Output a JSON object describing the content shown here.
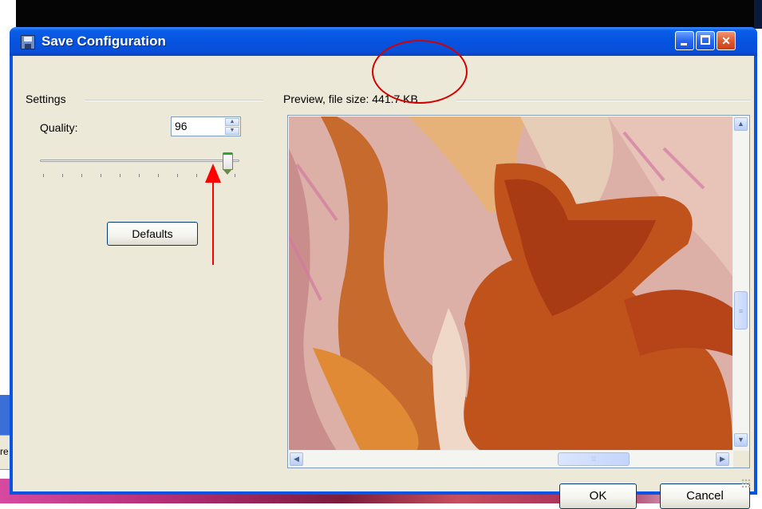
{
  "window": {
    "title": "Save Configuration",
    "controls": {
      "minimize": "minimize",
      "maximize": "maximize",
      "close": "close"
    }
  },
  "settings": {
    "group_label": "Settings",
    "quality_label": "Quality:",
    "quality_value": "96",
    "quality_slider_level": 0.96,
    "defaults_label": "Defaults"
  },
  "preview": {
    "group_label": "Preview, file size: 441.7 KB"
  },
  "footer": {
    "ok_label": "OK",
    "cancel_label": "Cancel"
  },
  "background": {
    "taskbar_fragment": "re"
  },
  "annotations": {
    "color": "#ff0000",
    "items": [
      "arrow pointing at quality slider",
      "circle around file size"
    ]
  },
  "colors": {
    "title_bar": "#0553e0",
    "dialog_face": "#ece9d8",
    "close_button": "#e05a30"
  }
}
